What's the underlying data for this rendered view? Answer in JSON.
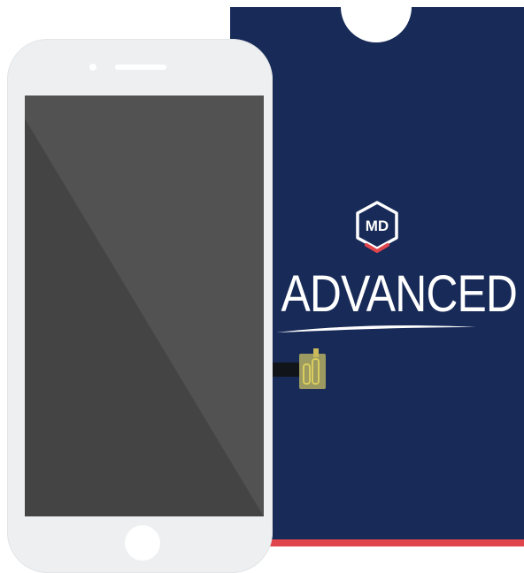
{
  "product": {
    "brand_badge": "MD",
    "wordmark": "ADVANCED"
  },
  "colors": {
    "packaging_navy": "#182a57",
    "accent_red": "#e0454c",
    "phone_body": "#edeff0",
    "screen_dark": "#4d4d4d",
    "screen_shade": "#444444",
    "connector_gold": "#c9b95a"
  },
  "icons": {
    "brand": "hexagon-badge-icon",
    "connector": "flex-connector-icon",
    "home": "home-button-icon"
  }
}
